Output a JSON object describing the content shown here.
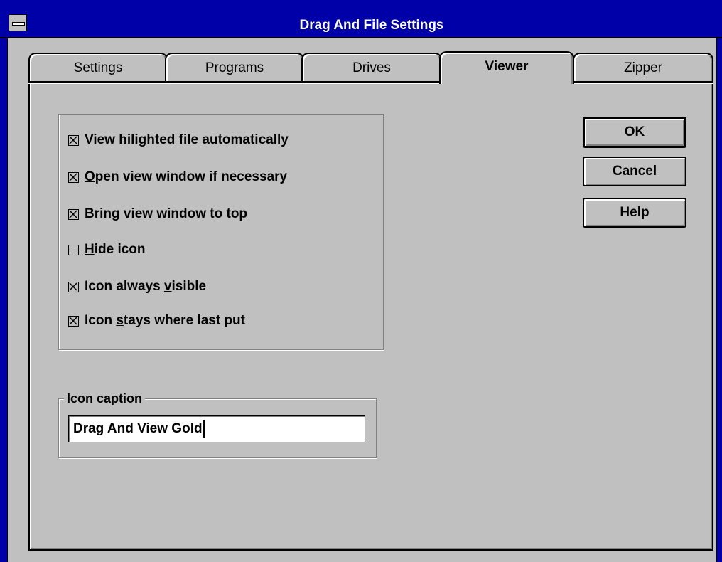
{
  "window": {
    "title": "Drag And File Settings"
  },
  "tabs": [
    {
      "label": "Settings",
      "active": false
    },
    {
      "label": "Programs",
      "active": false
    },
    {
      "label": "Drives",
      "active": false
    },
    {
      "label": "Viewer",
      "active": true
    },
    {
      "label": "Zipper",
      "active": false
    }
  ],
  "options": [
    {
      "label": "View hilighted file automatically",
      "checked": true
    },
    {
      "label_before": "",
      "mnemonic": "O",
      "label_after": "pen view window if necessary",
      "checked": true
    },
    {
      "label": "Bring view window to top",
      "checked": true
    },
    {
      "label_before": "",
      "mnemonic": "H",
      "label_after": "ide icon",
      "checked": false
    },
    {
      "label_before": "Icon always ",
      "mnemonic": "v",
      "label_after": "isible",
      "checked": true
    },
    {
      "label_before": "Icon ",
      "mnemonic": "s",
      "label_after": "tays where last put",
      "checked": true
    }
  ],
  "icon_caption": {
    "label": "Icon caption",
    "value": "Drag And View Gold"
  },
  "buttons": {
    "ok": "OK",
    "cancel": "Cancel",
    "help": "Help"
  },
  "colors": {
    "titlebar": "#0000a8",
    "face": "#c0c0c0"
  }
}
